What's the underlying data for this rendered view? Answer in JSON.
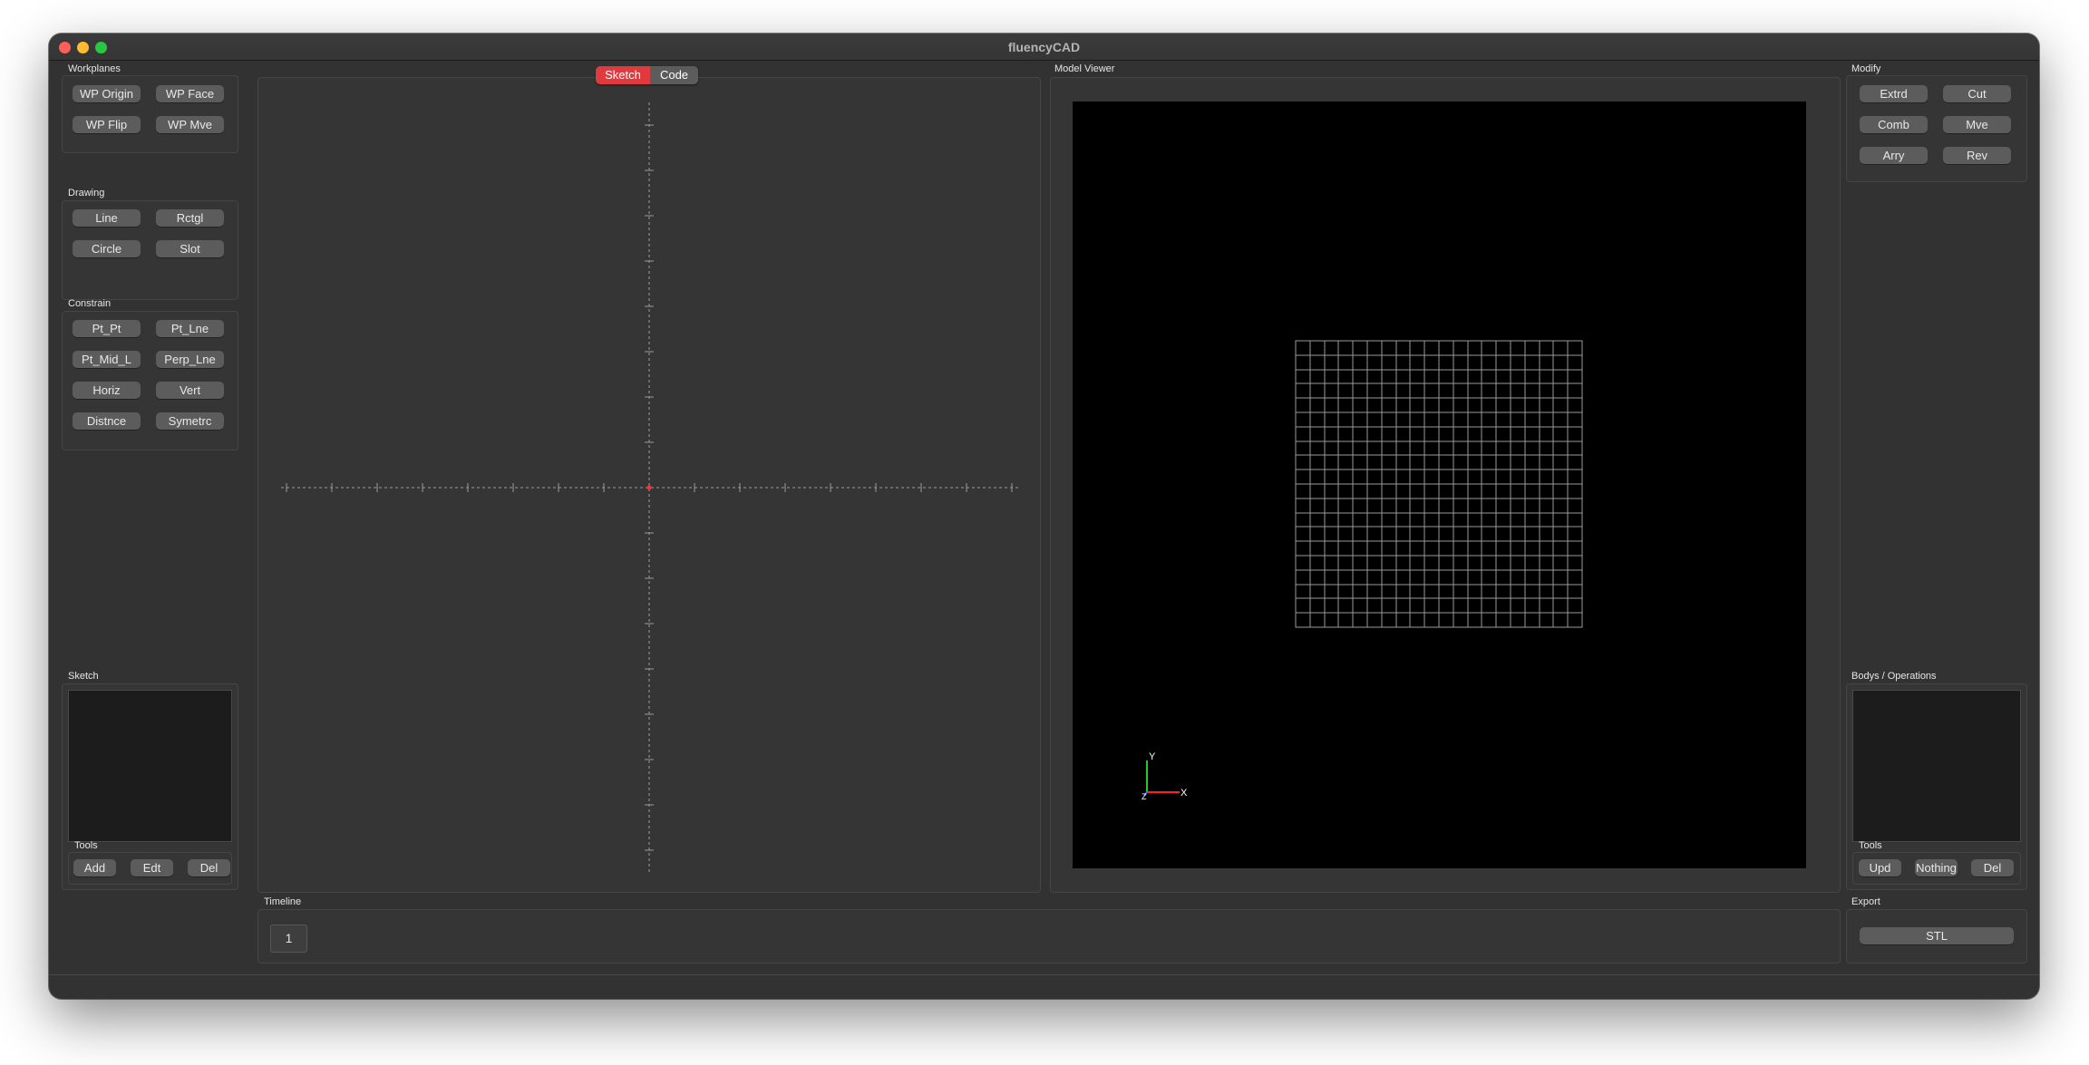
{
  "window": {
    "title": "fluencyCAD"
  },
  "left": {
    "workplanes": {
      "label": "Workplanes",
      "buttons": [
        "WP Origin",
        "WP Face",
        "WP Flip",
        "WP Mve"
      ]
    },
    "drawing": {
      "label": "Drawing",
      "buttons": [
        "Line",
        "Rctgl",
        "Circle",
        "Slot"
      ]
    },
    "constrain": {
      "label": "Constrain",
      "buttons": [
        "Pt_Pt",
        "Pt_Lne",
        "Pt_Mid_L",
        "Perp_Lne",
        "Horiz",
        "Vert",
        "Distnce",
        "Symetrc"
      ]
    },
    "sketch": {
      "label": "Sketch",
      "tools_label": "Tools",
      "tools": [
        "Add",
        "Edt",
        "Del"
      ]
    }
  },
  "center": {
    "tabs": [
      {
        "label": "Sketch",
        "active": true
      },
      {
        "label": "Code",
        "active": false
      }
    ]
  },
  "viewer": {
    "label": "Model Viewer",
    "axes": {
      "x": "X",
      "y": "Y",
      "z": "Z"
    }
  },
  "right": {
    "modify": {
      "label": "Modify",
      "buttons": [
        "Extrd",
        "Cut",
        "Comb",
        "Mve",
        "Arry",
        "Rev"
      ]
    },
    "bodies": {
      "label": "Bodys / Operations",
      "tools_label": "Tools",
      "tools": [
        "Upd",
        "Nothing",
        "Del"
      ]
    },
    "export": {
      "label": "Export",
      "button": "STL"
    }
  },
  "timeline": {
    "label": "Timeline",
    "steps": [
      "1"
    ]
  },
  "colors": {
    "accent": "#e0393e",
    "axis_x": "#ff2020",
    "axis_y": "#22cc22",
    "axis_z": "#4060ff"
  }
}
